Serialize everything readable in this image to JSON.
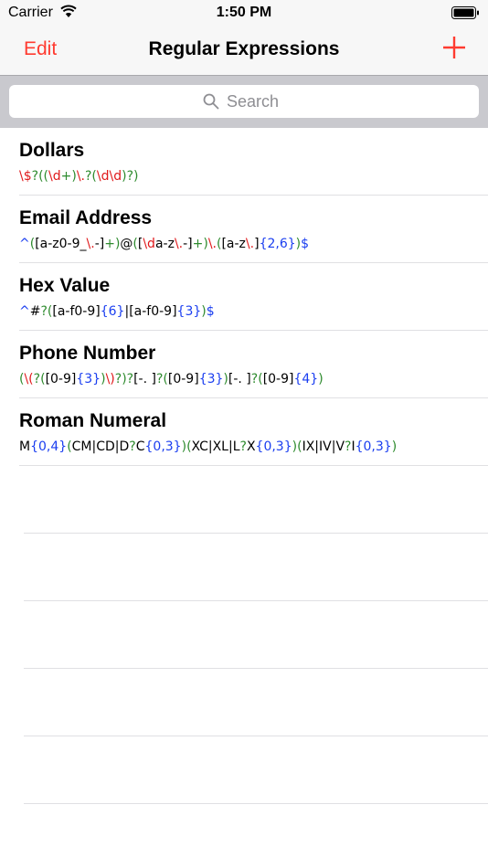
{
  "status_bar": {
    "carrier": "Carrier",
    "time": "1:50 PM"
  },
  "nav": {
    "edit_label": "Edit",
    "title": "Regular Expressions",
    "add_icon": "plus-icon"
  },
  "search": {
    "placeholder": "Search"
  },
  "colors": {
    "accent": "#ff3b30",
    "token_black": "#000000",
    "token_red": "#e0191b",
    "token_green": "#2e8b2e",
    "token_blue": "#1a3ef0",
    "token_gray": "#808080"
  },
  "regexes": [
    {
      "title": "Dollars",
      "tokens": [
        [
          "\\$",
          "r"
        ],
        [
          "?",
          "g"
        ],
        [
          "(",
          "g"
        ],
        [
          "(",
          "g"
        ],
        [
          "\\d",
          "r"
        ],
        [
          "+",
          "g"
        ],
        [
          ")",
          "g"
        ],
        [
          "\\.",
          "r"
        ],
        [
          "?",
          "g"
        ],
        [
          "(",
          "g"
        ],
        [
          "\\d\\d",
          "r"
        ],
        [
          ")",
          "g"
        ],
        [
          "?",
          "g"
        ],
        [
          ")",
          "g"
        ]
      ]
    },
    {
      "title": "Email Address",
      "tokens": [
        [
          "^",
          "b"
        ],
        [
          "(",
          "g"
        ],
        [
          "[a-z0-9_",
          "k"
        ],
        [
          "\\.",
          "r"
        ],
        [
          "-]",
          "k"
        ],
        [
          "+",
          "g"
        ],
        [
          ")",
          "g"
        ],
        [
          "@",
          "k"
        ],
        [
          "(",
          "g"
        ],
        [
          "[",
          "k"
        ],
        [
          "\\d",
          "r"
        ],
        [
          "a-z",
          "k"
        ],
        [
          "\\.",
          "r"
        ],
        [
          "-]",
          "k"
        ],
        [
          "+",
          "g"
        ],
        [
          ")",
          "g"
        ],
        [
          "\\.",
          "r"
        ],
        [
          "(",
          "g"
        ],
        [
          "[a-z",
          "k"
        ],
        [
          "\\.",
          "r"
        ],
        [
          "]",
          "k"
        ],
        [
          "{2,6}",
          "b"
        ],
        [
          ")",
          "g"
        ],
        [
          "$",
          "b"
        ]
      ]
    },
    {
      "title": "Hex Value",
      "tokens": [
        [
          "^",
          "b"
        ],
        [
          "#",
          "k"
        ],
        [
          "?",
          "g"
        ],
        [
          "(",
          "g"
        ],
        [
          "[a-f0-9]",
          "k"
        ],
        [
          "{6}",
          "b"
        ],
        [
          "|",
          "k"
        ],
        [
          "[a-f0-9]",
          "k"
        ],
        [
          "{3}",
          "b"
        ],
        [
          ")",
          "g"
        ],
        [
          "$",
          "b"
        ]
      ]
    },
    {
      "title": "Phone Number",
      "tokens": [
        [
          "(",
          "g"
        ],
        [
          "\\(",
          "r"
        ],
        [
          "?",
          "g"
        ],
        [
          "(",
          "g"
        ],
        [
          "[0-9]",
          "k"
        ],
        [
          "{3}",
          "b"
        ],
        [
          ")",
          "g"
        ],
        [
          "\\)",
          "r"
        ],
        [
          "?",
          "g"
        ],
        [
          ")",
          "g"
        ],
        [
          "?",
          "g"
        ],
        [
          "[-. ]",
          "k"
        ],
        [
          "?",
          "g"
        ],
        [
          "(",
          "g"
        ],
        [
          "[0-9]",
          "k"
        ],
        [
          "{3}",
          "b"
        ],
        [
          ")",
          "g"
        ],
        [
          "[-. ]",
          "k"
        ],
        [
          "?",
          "g"
        ],
        [
          "(",
          "g"
        ],
        [
          "[0-9]",
          "k"
        ],
        [
          "{4}",
          "b"
        ],
        [
          ")",
          "g"
        ]
      ]
    },
    {
      "title": "Roman Numeral",
      "tokens": [
        [
          "M",
          "k"
        ],
        [
          "{0,4}",
          "b"
        ],
        [
          "(",
          "g"
        ],
        [
          "CM|CD|D",
          "k"
        ],
        [
          "?",
          "g"
        ],
        [
          "C",
          "k"
        ],
        [
          "{0,3}",
          "b"
        ],
        [
          ")",
          "g"
        ],
        [
          "(",
          "g"
        ],
        [
          "XC|XL|L",
          "k"
        ],
        [
          "?",
          "g"
        ],
        [
          "X",
          "k"
        ],
        [
          "{0,3}",
          "b"
        ],
        [
          ")",
          "g"
        ],
        [
          "(",
          "g"
        ],
        [
          "IX|IV|V",
          "k"
        ],
        [
          "?",
          "g"
        ],
        [
          "I",
          "k"
        ],
        [
          "{0,3}",
          "b"
        ],
        [
          ")",
          "g"
        ]
      ]
    }
  ]
}
